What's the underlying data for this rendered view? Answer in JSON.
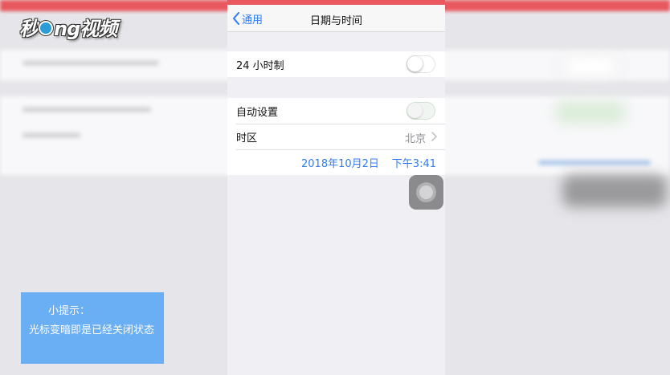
{
  "watermark": {
    "logo_text": "秒dong视频"
  },
  "nav": {
    "back_label": "通用",
    "title": "日期与时间"
  },
  "settings": {
    "hour24": {
      "label": "24 小时制",
      "on": false
    },
    "auto_set": {
      "label": "自动设置",
      "on": false
    },
    "timezone": {
      "label": "时区",
      "value": "北京"
    },
    "date": "2018年10月2日",
    "time": "下午3:41"
  },
  "tip": {
    "title": "小提示：",
    "body": "光标变暗即是已经关闭状态"
  },
  "colors": {
    "accent": "#2f7cf6",
    "tip_bg": "#6aaef4",
    "top_bar": "#e8585e"
  }
}
